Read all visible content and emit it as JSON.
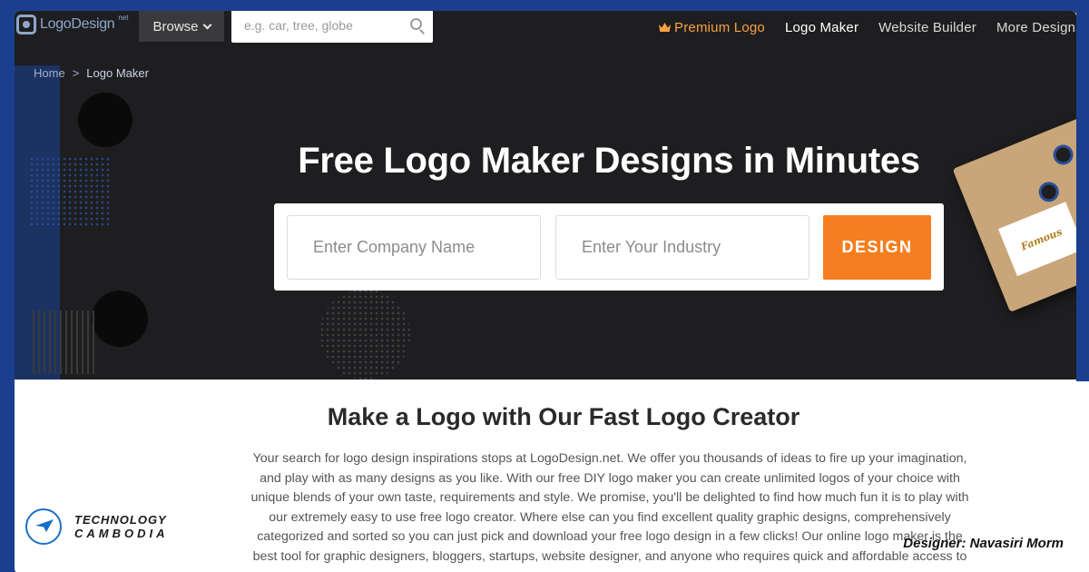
{
  "nav": {
    "logo_text": "LogoDesign",
    "logo_suffix": "net",
    "browse_label": "Browse",
    "search_placeholder": "e.g. car, tree, globe",
    "links": [
      "Premium Logo",
      "Logo Maker",
      "Website Builder",
      "More Designs"
    ]
  },
  "breadcrumb": {
    "home": "Home",
    "separator": ">",
    "current": "Logo Maker"
  },
  "hero": {
    "title": "Free Logo Maker Designs in Minutes",
    "company_placeholder": "Enter Company Name",
    "industry_placeholder": "Enter Your Industry",
    "design_button": "DESIGN",
    "envelope_card_text": "Famous"
  },
  "content": {
    "title": "Make a Logo with Our Fast Logo Creator",
    "body": "Your search for logo design inspirations stops at LogoDesign.net. We offer you thousands of ideas to fire up your imagination, and play with as many designs as you like. With our free DIY logo maker you can create unlimited logos of your choice with unique blends of your own taste, requirements and style. We promise, you'll be delighted to find how much fun it is to play with our extremely easy to use free logo creator. Where else can you find excellent quality graphic designs, comprehensively categorized and sorted so you can just pick and download your free logo design in a few clicks! Our online logo maker is the best tool for graphic designers, bloggers, startups, website designer, and anyone who requires quick and affordable access to"
  },
  "overlay": {
    "brand_line1": "TECHNOLOGY",
    "brand_line2": "CAMBODIA",
    "designer": "Designer: Navasiri Morm"
  },
  "colors": {
    "accent": "#f47f20",
    "premium": "#f7a240",
    "hero_bg": "#1e1e20",
    "frame_blue": "#1b3f8f"
  },
  "icons": [
    "logo-mark-icon",
    "chevron-down-icon",
    "search-icon",
    "crown-icon",
    "brand-bird-icon"
  ]
}
